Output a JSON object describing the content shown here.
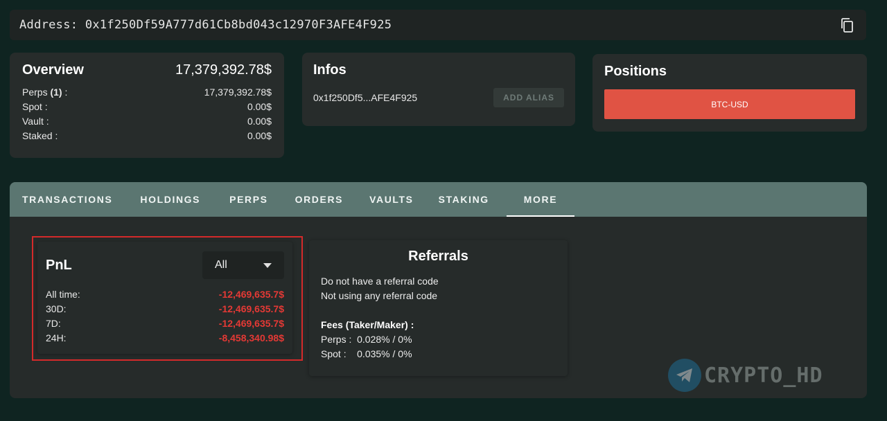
{
  "address_bar": {
    "label": "Address:",
    "address": "0x1f250Df59A777d61Cb8bd043c12970F3AFE4F925",
    "copy_icon": "copy-icon"
  },
  "overview": {
    "title": "Overview",
    "total": "17,379,392.78$",
    "rows": [
      {
        "label_pre": "Perps ",
        "label_count": "(1)",
        "label_post": " :",
        "value": "17,379,392.78$"
      },
      {
        "label": "Spot :",
        "value": "0.00$"
      },
      {
        "label": "Vault :",
        "value": "0.00$"
      },
      {
        "label": "Staked :",
        "value": "0.00$"
      }
    ]
  },
  "infos": {
    "title": "Infos",
    "short_address": "0x1f250Df5...AFE4F925",
    "alias_button": "ADD ALIAS"
  },
  "positions": {
    "title": "Positions",
    "items": [
      "BTC-USD"
    ],
    "button_color": "#e05344"
  },
  "tabs": [
    {
      "label": "TRANSACTIONS",
      "active": false
    },
    {
      "label": "HOLDINGS",
      "active": false
    },
    {
      "label": "PERPS",
      "active": false
    },
    {
      "label": "ORDERS",
      "active": false
    },
    {
      "label": "VAULTS",
      "active": false
    },
    {
      "label": "STAKING",
      "active": false
    },
    {
      "label": "MORE",
      "active": true
    }
  ],
  "pnl": {
    "title": "PnL",
    "select_value": "All",
    "rows": [
      {
        "label": "All time:",
        "value": "-12,469,635.7$"
      },
      {
        "label": "30D:",
        "value": "-12,469,635.7$"
      },
      {
        "label": "7D:",
        "value": "-12,469,635.7$"
      },
      {
        "label": "24H:",
        "value": "-8,458,340.98$"
      }
    ],
    "negative_color": "#e53935"
  },
  "referrals": {
    "title": "Referrals",
    "line1": "Do not have a referral code",
    "line2": "Not using any referral code",
    "fees_label": "Fees (Taker/Maker) :",
    "perps_fees": "Perps :  0.028% / 0%",
    "spot_fees": "Spot :    0.035% / 0%"
  },
  "watermark": {
    "text": "CRYPTO_HD",
    "icon": "telegram-icon"
  }
}
